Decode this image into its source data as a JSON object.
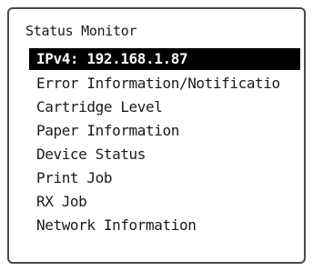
{
  "screen": {
    "title": "Status Monitor"
  },
  "menu": {
    "items": [
      {
        "label": "IPv4: 192.168.1.87",
        "selected": true
      },
      {
        "label": "Error Information/Notificatio",
        "selected": false
      },
      {
        "label": "Cartridge Level",
        "selected": false
      },
      {
        "label": "Paper Information",
        "selected": false
      },
      {
        "label": "Device Status",
        "selected": false
      },
      {
        "label": "Print Job",
        "selected": false
      },
      {
        "label": "RX Job",
        "selected": false
      },
      {
        "label": "Network Information",
        "selected": false
      }
    ]
  },
  "colors": {
    "highlight_bg": "#000000",
    "highlight_text": "#ffffff",
    "frame": "#4a4a4a"
  }
}
